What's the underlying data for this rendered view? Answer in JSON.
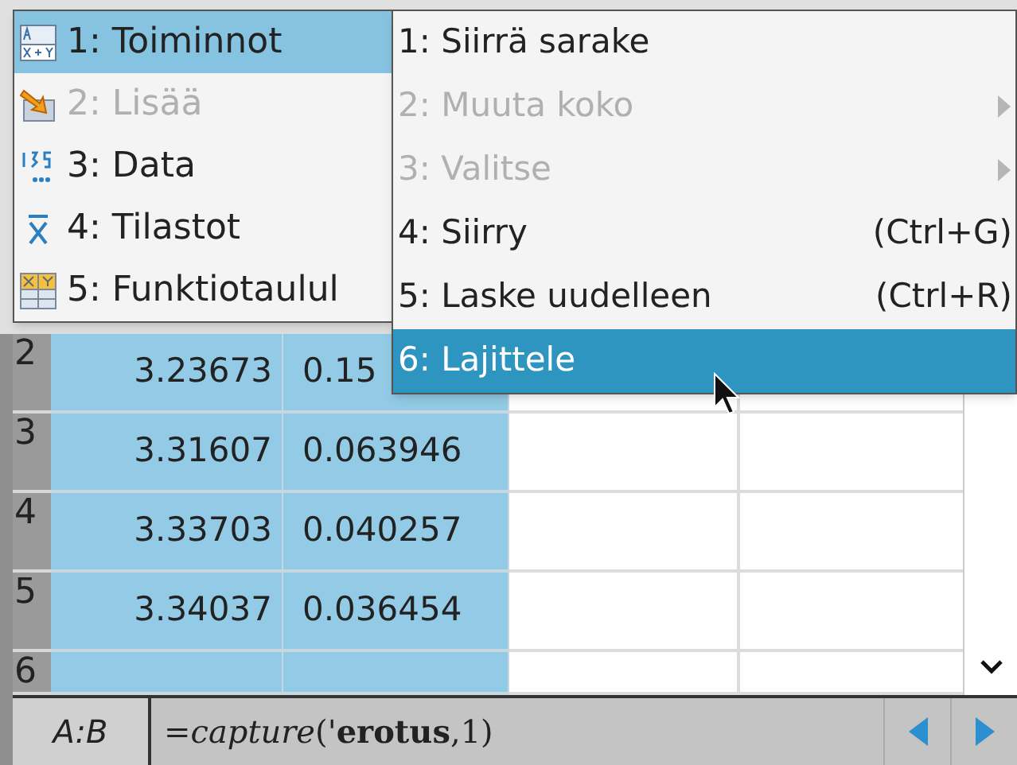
{
  "menu": {
    "items": [
      {
        "label": "1: Toiminnot",
        "selected": true,
        "disabled": false
      },
      {
        "label": "2: Lisää",
        "selected": false,
        "disabled": true
      },
      {
        "label": "3: Data",
        "selected": false,
        "disabled": false
      },
      {
        "label": "4: Tilastot",
        "selected": false,
        "disabled": false
      },
      {
        "label": "5: Funktiotaulul",
        "selected": false,
        "disabled": false
      }
    ]
  },
  "submenu": {
    "items": [
      {
        "label": "1: Siirrä sarake",
        "selected": false,
        "disabled": false,
        "kind": "plain"
      },
      {
        "label": "2: Muuta koko",
        "selected": false,
        "disabled": true,
        "kind": "submenu"
      },
      {
        "label": "3: Valitse",
        "selected": false,
        "disabled": true,
        "kind": "submenu"
      },
      {
        "label": "4: Siirry",
        "selected": false,
        "disabled": false,
        "kind": "shortcut",
        "shortcut": "(Ctrl+G)"
      },
      {
        "label": "5: Laske uudelleen",
        "selected": false,
        "disabled": false,
        "kind": "shortcut",
        "shortcut": "(Ctrl+R)"
      },
      {
        "label": "6: Lajittele",
        "selected": true,
        "disabled": false,
        "kind": "plain"
      }
    ]
  },
  "table": {
    "rows": [
      {
        "number": "2",
        "cells": [
          "3.23673",
          "0.15"
        ]
      },
      {
        "number": "3",
        "cells": [
          "3.31607",
          "0.063946"
        ]
      },
      {
        "number": "4",
        "cells": [
          "3.33703",
          "0.040257"
        ]
      },
      {
        "number": "5",
        "cells": [
          "3.34037",
          "0.036454"
        ]
      },
      {
        "number": "6",
        "cells": []
      }
    ]
  },
  "entry_line": {
    "cell_ref": "A:B",
    "formula": "=*capture*('**erotus**,1)"
  }
}
